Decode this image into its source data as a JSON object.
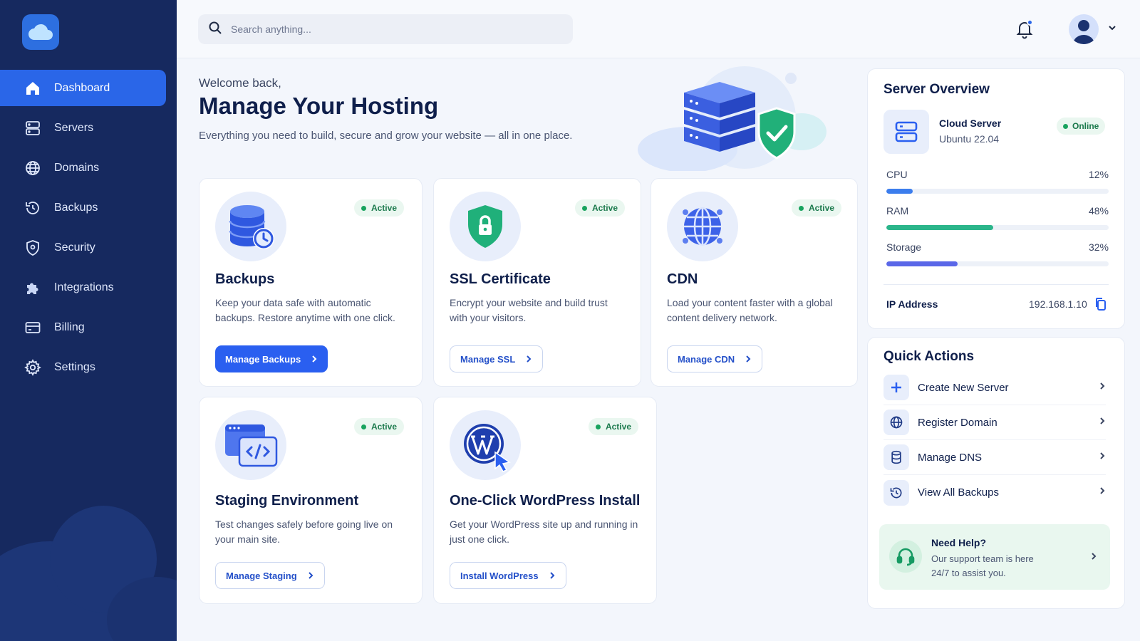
{
  "search": {
    "placeholder": "Search anything..."
  },
  "sidebar": {
    "items": [
      {
        "label": "Dashboard",
        "icon": "home-icon",
        "active": true
      },
      {
        "label": "Servers",
        "icon": "server-icon"
      },
      {
        "label": "Domains",
        "icon": "globe-icon"
      },
      {
        "label": "Backups",
        "icon": "history-icon"
      },
      {
        "label": "Security",
        "icon": "shield-icon"
      },
      {
        "label": "Integrations",
        "icon": "puzzle-icon"
      },
      {
        "label": "Billing",
        "icon": "card-icon"
      },
      {
        "label": "Settings",
        "icon": "gear-icon"
      }
    ]
  },
  "header": {
    "welcome": "Welcome back,",
    "title": "Manage Your Hosting",
    "subtitle": "Everything you need to build, secure and grow your website — all in one place."
  },
  "cards": [
    {
      "title": "Backups",
      "status": "Active",
      "description": "Keep your data safe with automatic backups. Restore anytime with one click.",
      "button": "Manage Backups",
      "icon": "database-clock-icon"
    },
    {
      "title": "SSL Certificate",
      "status": "Active",
      "description": "Encrypt your website and build trust with your visitors.",
      "button": "Manage SSL",
      "icon": "shield-lock-icon"
    },
    {
      "title": "CDN",
      "status": "Active",
      "description": "Load your content faster with a global content delivery network.",
      "button": "Manage CDN",
      "icon": "globe-network-icon"
    },
    {
      "title": "Staging Environment",
      "status": "Active",
      "description": "Test changes safely before going live on your main site.",
      "button": "Manage Staging",
      "icon": "code-window-icon"
    },
    {
      "title": "One-Click WordPress Install",
      "status": "Active",
      "description": "Get your WordPress site up and running in just one click.",
      "button": "Install WordPress",
      "icon": "wordpress-icon"
    }
  ],
  "server_overview": {
    "title": "Server Overview",
    "name": "Cloud Server",
    "os": "Ubuntu 22.04",
    "status": "Online",
    "metrics": [
      {
        "label": "CPU",
        "value": "12%",
        "percent": 12,
        "color": "#3b7ded"
      },
      {
        "label": "RAM",
        "value": "48%",
        "percent": 48,
        "color": "#2bb58a"
      },
      {
        "label": "Storage",
        "value": "32%",
        "percent": 32,
        "color": "#5a67e8"
      }
    ],
    "ip_label": "IP Address",
    "ip_value": "192.168.1.10"
  },
  "quick_actions": {
    "title": "Quick Actions",
    "items": [
      {
        "label": "Create New Server",
        "icon": "plus-icon"
      },
      {
        "label": "Register Domain",
        "icon": "globe-icon"
      },
      {
        "label": "Manage DNS",
        "icon": "database-icon"
      },
      {
        "label": "View All Backups",
        "icon": "history-icon"
      }
    ],
    "help": {
      "title": "Need Help?",
      "description": "Our support team is here 24/7 to assist you."
    }
  }
}
